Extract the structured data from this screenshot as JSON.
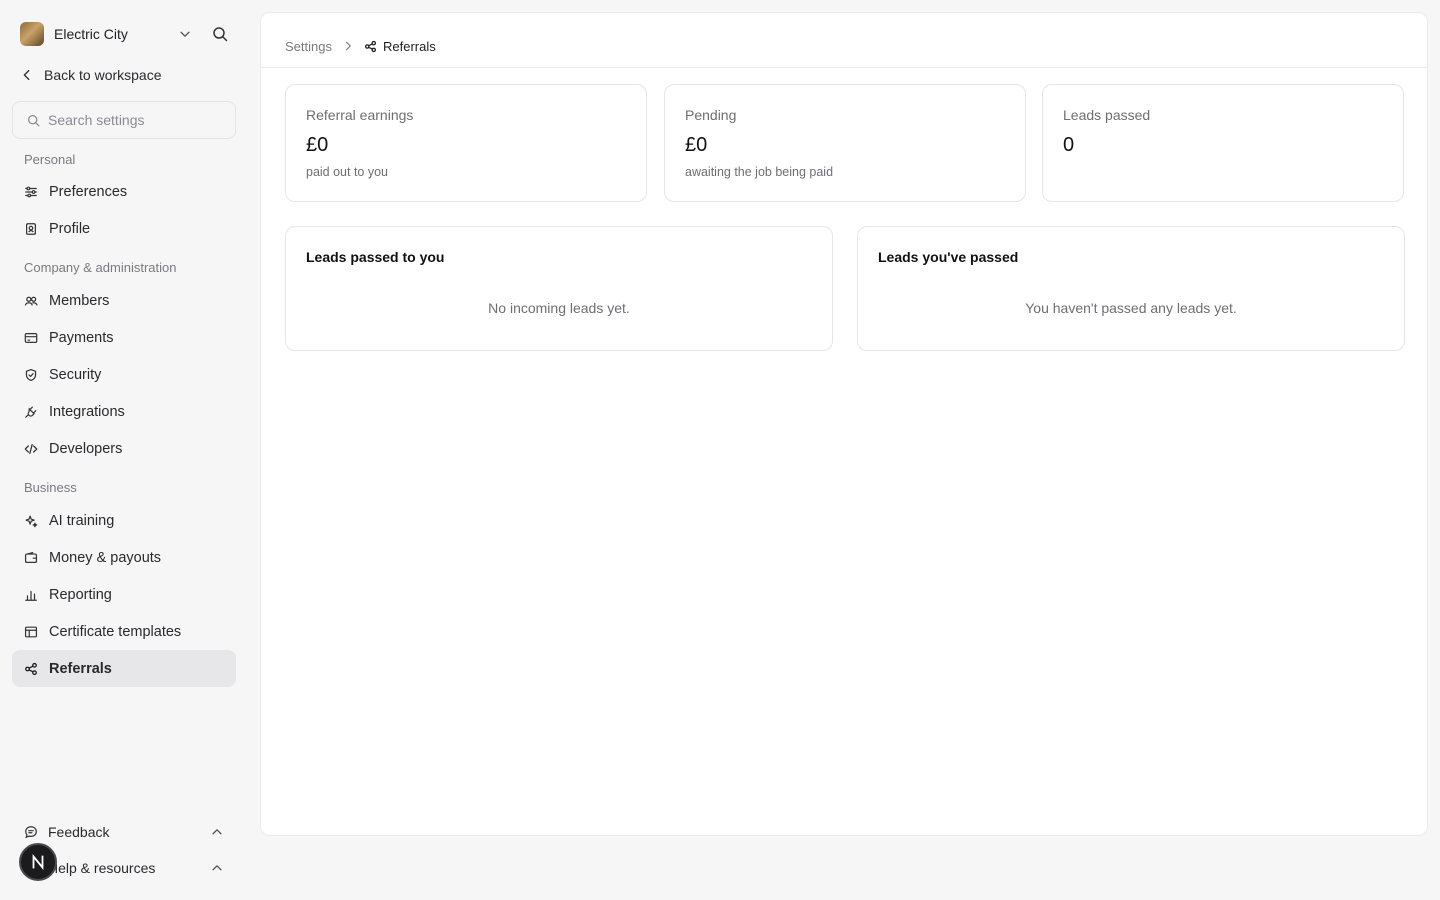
{
  "workspace": {
    "name": "Electric City",
    "icons": {
      "avatar": "workspace-avatar",
      "switch": "chevron-down-icon",
      "search": "search-icon"
    }
  },
  "sidebar": {
    "back_label": "Back to workspace",
    "search_placeholder": "Search settings",
    "sections": {
      "personal": "Personal",
      "company": "Company & administration",
      "business": "Business"
    },
    "items": {
      "preferences": {
        "label": "Preferences",
        "icon": "sliders-icon"
      },
      "profile": {
        "label": "Profile",
        "icon": "id-badge-icon"
      },
      "members": {
        "label": "Members",
        "icon": "users-icon"
      },
      "payments": {
        "label": "Payments",
        "icon": "credit-card-icon"
      },
      "security": {
        "label": "Security",
        "icon": "shield-icon"
      },
      "integrations": {
        "label": "Integrations",
        "icon": "plug-icon"
      },
      "developers": {
        "label": "Developers",
        "icon": "code-icon"
      },
      "ai_training": {
        "label": "AI training",
        "icon": "sparkle-icon"
      },
      "money": {
        "label": "Money & payouts",
        "icon": "wallet-icon"
      },
      "reporting": {
        "label": "Reporting",
        "icon": "bar-chart-icon"
      },
      "certificates": {
        "label": "Certificate templates",
        "icon": "table-icon"
      },
      "referrals": {
        "label": "Referrals",
        "icon": "share-icon",
        "active": true
      }
    },
    "footer": {
      "feedback": "Feedback",
      "help": "Help & resources",
      "fab_letter": "N"
    }
  },
  "breadcrumb": {
    "root": "Settings",
    "current": "Referrals"
  },
  "stats": {
    "earnings": {
      "label": "Referral earnings",
      "value": "£0",
      "sub": "paid out to you"
    },
    "pending": {
      "label": "Pending",
      "value": "£0",
      "sub": "awaiting the job being paid"
    },
    "leads": {
      "label": "Leads passed",
      "value": "0"
    }
  },
  "leads": {
    "incoming": {
      "title": "Leads passed to you",
      "empty": "No incoming leads yet."
    },
    "outgoing": {
      "title": "Leads you've passed",
      "empty": "You haven't passed any leads yet."
    }
  },
  "colors": {
    "background": "#f6f6f7",
    "panel": "#ffffff",
    "active_nav": "#e7e7ea",
    "text": "#1f1f22",
    "muted": "#6e6e76"
  }
}
